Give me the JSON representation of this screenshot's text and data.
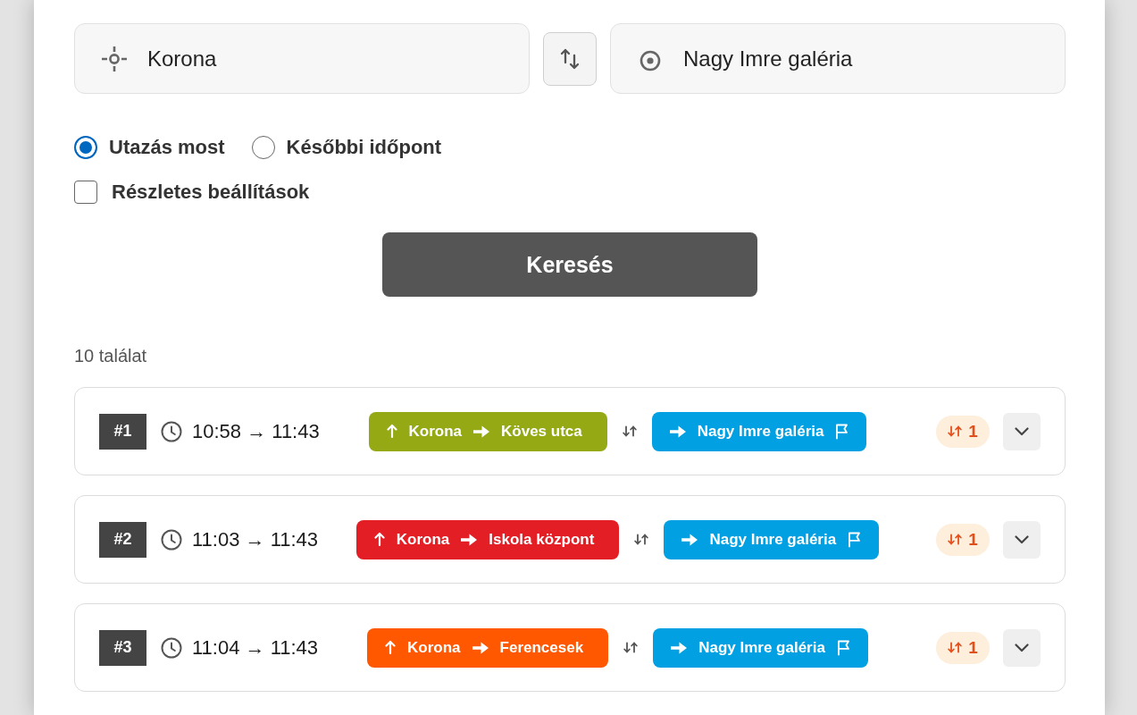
{
  "route_form": {
    "origin": {
      "value": "Korona"
    },
    "destination": {
      "value": "Nagy Imre galéria"
    },
    "time_options": [
      {
        "label": "Utazás most",
        "selected": true
      },
      {
        "label": "Későbbi időpont",
        "selected": false
      }
    ],
    "detailed_settings": {
      "label": "Részletes beállítások",
      "checked": false
    },
    "search_button": "Keresés"
  },
  "results": {
    "count": "10 találat",
    "items": [
      {
        "rank": "#1",
        "time": "10:58 → 11:43",
        "legs": [
          {
            "color": "#94a914",
            "from": "Korona",
            "to": "Köves utca"
          },
          {
            "color": "#00a0e3",
            "to": "Nagy Imre galéria"
          }
        ],
        "transfers": "1",
        "expanded": false
      },
      {
        "rank": "#2",
        "time": "11:03 → 11:43",
        "legs": [
          {
            "color": "#e31e25",
            "from": "Korona",
            "to": "Iskola központ"
          },
          {
            "color": "#00a0e3",
            "to": "Nagy Imre galéria"
          }
        ],
        "transfers": "1",
        "expanded": false
      },
      {
        "rank": "#3",
        "time": "11:04 → 11:43",
        "legs": [
          {
            "color": "#ff5800",
            "from": "Korona",
            "to": "Ferencesek"
          },
          {
            "color": "#00a0e3",
            "to": "Nagy Imre galéria"
          }
        ],
        "transfers": "1",
        "expanded": false
      }
    ]
  }
}
